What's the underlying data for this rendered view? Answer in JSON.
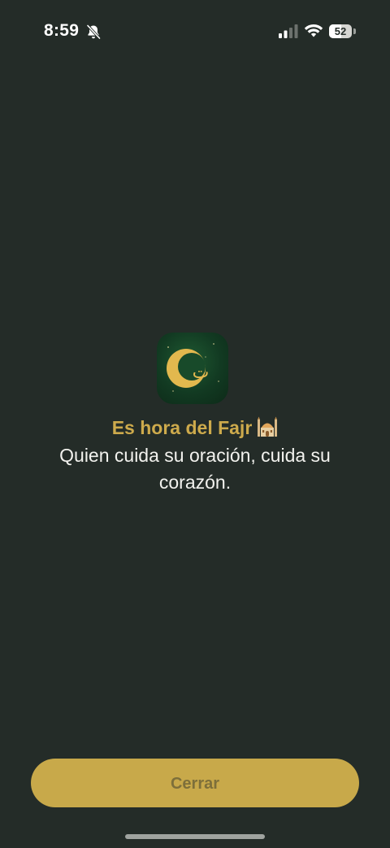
{
  "status_bar": {
    "time": "8:59",
    "silent_mode_icon": "bell-slash-icon",
    "cellular_icon": "signal-bars-icon",
    "wifi_icon": "wifi-icon",
    "battery_level": "52"
  },
  "app_icon": {
    "icon": "crescent-moon-icon",
    "glyph": "ت"
  },
  "notification": {
    "title": "Es hora del Fajr",
    "title_icon": "mosque-icon",
    "message": "Quien cuida su oración, cuida su corazón."
  },
  "actions": {
    "close_label": "Cerrar"
  },
  "colors": {
    "background": "#242c28",
    "accent_gold": "#c8a94a",
    "title_gold": "#cdaa4c",
    "button_text": "#7d6f3a",
    "text_light": "#f2f2ee"
  }
}
